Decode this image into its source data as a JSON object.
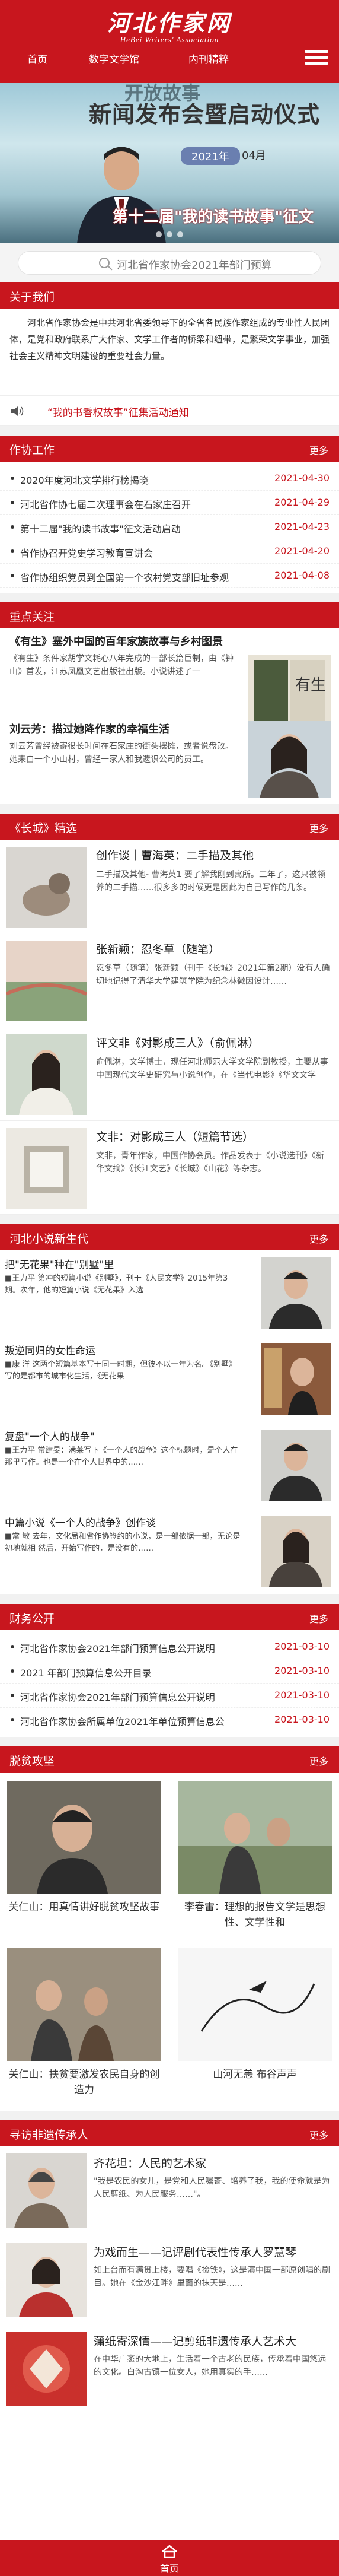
{
  "header": {
    "logo_cn": "河北作家网",
    "logo_en": "HeBei Writers' Association",
    "nav": [
      "首页",
      "数字文学馆",
      "内刊精粹"
    ]
  },
  "banner": {
    "title_top": "开放故事",
    "title": "新闻发布会暨启动仪式",
    "date": "2021年",
    "date_suffix": "04月",
    "caption": "第十二届\"我的读书故事\"征文"
  },
  "search": {
    "placeholder": "河北省作家协会2021年部门预算"
  },
  "about": {
    "title": "关于我们",
    "text": "河北省作家协会是中共河北省委领导下的全省各民族作家组成的专业性人民团体，是党和政府联系广大作家、文学工作者的桥梁和纽带，是繁荣文学事业，加强社会主义精神文明建设的重要社会力量。"
  },
  "notice": {
    "text": "“我的书香权故事”征集活动通知"
  },
  "work": {
    "title": "作协工作",
    "more": "更多",
    "items": [
      {
        "title": "2020年度河北文学排行榜揭晓",
        "date": "2021-04-30"
      },
      {
        "title": "河北省作协七届二次理事会在石家庄召开",
        "date": "2021-04-29"
      },
      {
        "title": "第十二届\"我的读书故事\"征文活动启动",
        "date": "2021-04-23"
      },
      {
        "title": "省作协召开党史学习教育宣讲会",
        "date": "2021-04-20"
      },
      {
        "title": "省作协组织党员到全国第一个农村党支部旧址参观",
        "date": "2021-04-08"
      }
    ]
  },
  "focus": {
    "title": "重点关注",
    "items": [
      {
        "title": "《有生》塞外中国的百年家族故事与乡村图景",
        "desc": "《有生》条件家胡学文耗心八年完成的一部长篇巨制，由《钟山》首发，江苏凤凰文艺出版社出版。小说讲述了一"
      },
      {
        "title": "刘云芳：描过她降作家的幸福生活",
        "desc": "刘云芳曾经被寄很长时间在石家庄的街头摆摊，或者说盘改。她来自一个小山村，曾经一家人和我遗识公司的员工。"
      }
    ]
  },
  "changcheng": {
    "title": "《长城》精选",
    "more": "更多",
    "items": [
      {
        "title": "创作谈｜曹海英：二手描及其他",
        "desc": "二手描及其他- 曹海英1 要了解我刚到寓所。三年了，这只被领养的二手描……很多多的时候更是因此为自己写作的几条。"
      },
      {
        "title": "张新颖：忍冬草（随笔）",
        "desc": "忍冬草（随笔）张新颖（刊于《长城》2021年第2期）没有人确切地记得了清华大学建筑学院为纪念林徽因设计……"
      },
      {
        "title": "评文非《对影成三人》（俞佩淋）",
        "desc": "俞佩淋，文学博士，现任河北师范大学文学院副教授，主要从事中国现代文学史研究与小说创作，在《当代电影》《华文文学"
      },
      {
        "title": "文非：对影成三人（短篇节选）",
        "desc": "文非，青年作家，中国作协会员。作品发表于《小说选刊》《新华文摘》《长江文艺》《长城》《山花》等杂志。"
      }
    ]
  },
  "newgen": {
    "title": "河北小说新生代",
    "more": "更多",
    "items": [
      {
        "title": "把\"无花果\"种在\"别墅\"里",
        "desc": "■王力平 第冲的短篇小说《别墅》，刊于《人民文学》2015年第3期。次年，他的短篇小说《无花果》入选"
      },
      {
        "title": "叛逆同归的女性命运",
        "desc": "■康 洋 这两个短篇基本写于同一时期，但彼不以一年为名。《别墅》写的是都市的城市化生活，《无花果"
      },
      {
        "title": "复盘\"一个人的战争\"",
        "desc": "■王力平 常建旻：满莱写下《一个人的战争》这个标题时，是个人在那里写作。也是一个在个人世界中的……"
      },
      {
        "title": "中篇小说《一个人的战争》创作谈",
        "desc": "■常 敏 去年，文化局和省作协签约的小说，是一部依据一部，无论是初地就相 然后，开始写作的，是没有的……"
      }
    ]
  },
  "finance": {
    "title": "财务公开",
    "more": "更多",
    "items": [
      {
        "title": "河北省作家协会2021年部门预算信息公开说明",
        "date": "2021-03-10"
      },
      {
        "title": "2021 年部门预算信息公开目录",
        "date": "2021-03-10"
      },
      {
        "title": "河北省作家协会2021年部门预算信息公开说明",
        "date": "2021-03-10"
      },
      {
        "title": "河北省作家协会所属单位2021年单位预算信息公",
        "date": "2021-03-10"
      }
    ]
  },
  "poverty": {
    "title": "脱贫攻坚",
    "more": "更多",
    "items": [
      {
        "caption": "关仁山：用真情讲好脱贫攻坚故事"
      },
      {
        "caption": "李春雷：理想的报告文学是思想性、文学性和"
      },
      {
        "caption": "关仁山：扶贫要激发农民自身的创造力"
      },
      {
        "caption": "山河无恙 布谷声声"
      }
    ]
  },
  "ich": {
    "title": "寻访非遗传承人",
    "more": "更多",
    "items": [
      {
        "title": "齐花坦：人民的艺术家",
        "desc": "\"我是农民的女儿，是党和人民嘱寄、培养了我，我的使命就是为人民剪纸、为人民服务……\"。"
      },
      {
        "title": "为戏而生——记评剧代表性传承人罗慧琴",
        "desc": "如上台而有满贯上楼，要唱《捡铁》，这是演中国一部原创唱的剧目。她在《金沙江畔》里面的抹天是……"
      },
      {
        "title": "蒲纸寄深情——记剪纸非遗传承人艺术大",
        "desc": "在中华广袤的大地上，生活着一个古老的民族，传承着中国悠远的文化。白沟古镇一位女人，她用真实的手……"
      }
    ]
  },
  "footer": {
    "home": "首页"
  },
  "colors": {
    "brand": "#c8161e"
  }
}
